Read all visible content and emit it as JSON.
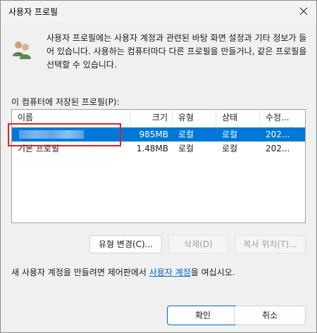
{
  "window": {
    "title": "사용자 프로필"
  },
  "description": "사용자 프로필에는 사용자 계정과 관련된 바탕 화면 설정과 기타 정보가 들어 있습니다. 사용하는 컴퓨터마다 다른 프로필을 만들거나, 같은 프로필을 선택할 수 있습니다.",
  "profiles_label": "이 컴퓨터에 저장된 프로필(P):",
  "table": {
    "columns": [
      "이름",
      "크기",
      "유형",
      "상태",
      "수정..."
    ],
    "rows": [
      {
        "name": "",
        "size": "985MB",
        "type": "로컬",
        "status": "로컬",
        "modified": "202...",
        "selected": true
      },
      {
        "name": "기본 프로필",
        "size": "1.48MB",
        "type": "로컬",
        "status": "로컬",
        "modified": "202...",
        "selected": false
      }
    ]
  },
  "buttons": {
    "change_type": "유형 변경(C)...",
    "delete": "삭제(D)",
    "copy_to": "복사 위치(T)..."
  },
  "hint": {
    "prefix": "새 사용자 계정을 만들려면 제어판에서 ",
    "link": "사용자 계정",
    "suffix": "을 여십시오."
  },
  "footer": {
    "ok": "확인",
    "cancel": "취소"
  },
  "colors": {
    "selection": "#0078d7",
    "link": "#0066cc",
    "annotation": "#e02020"
  }
}
